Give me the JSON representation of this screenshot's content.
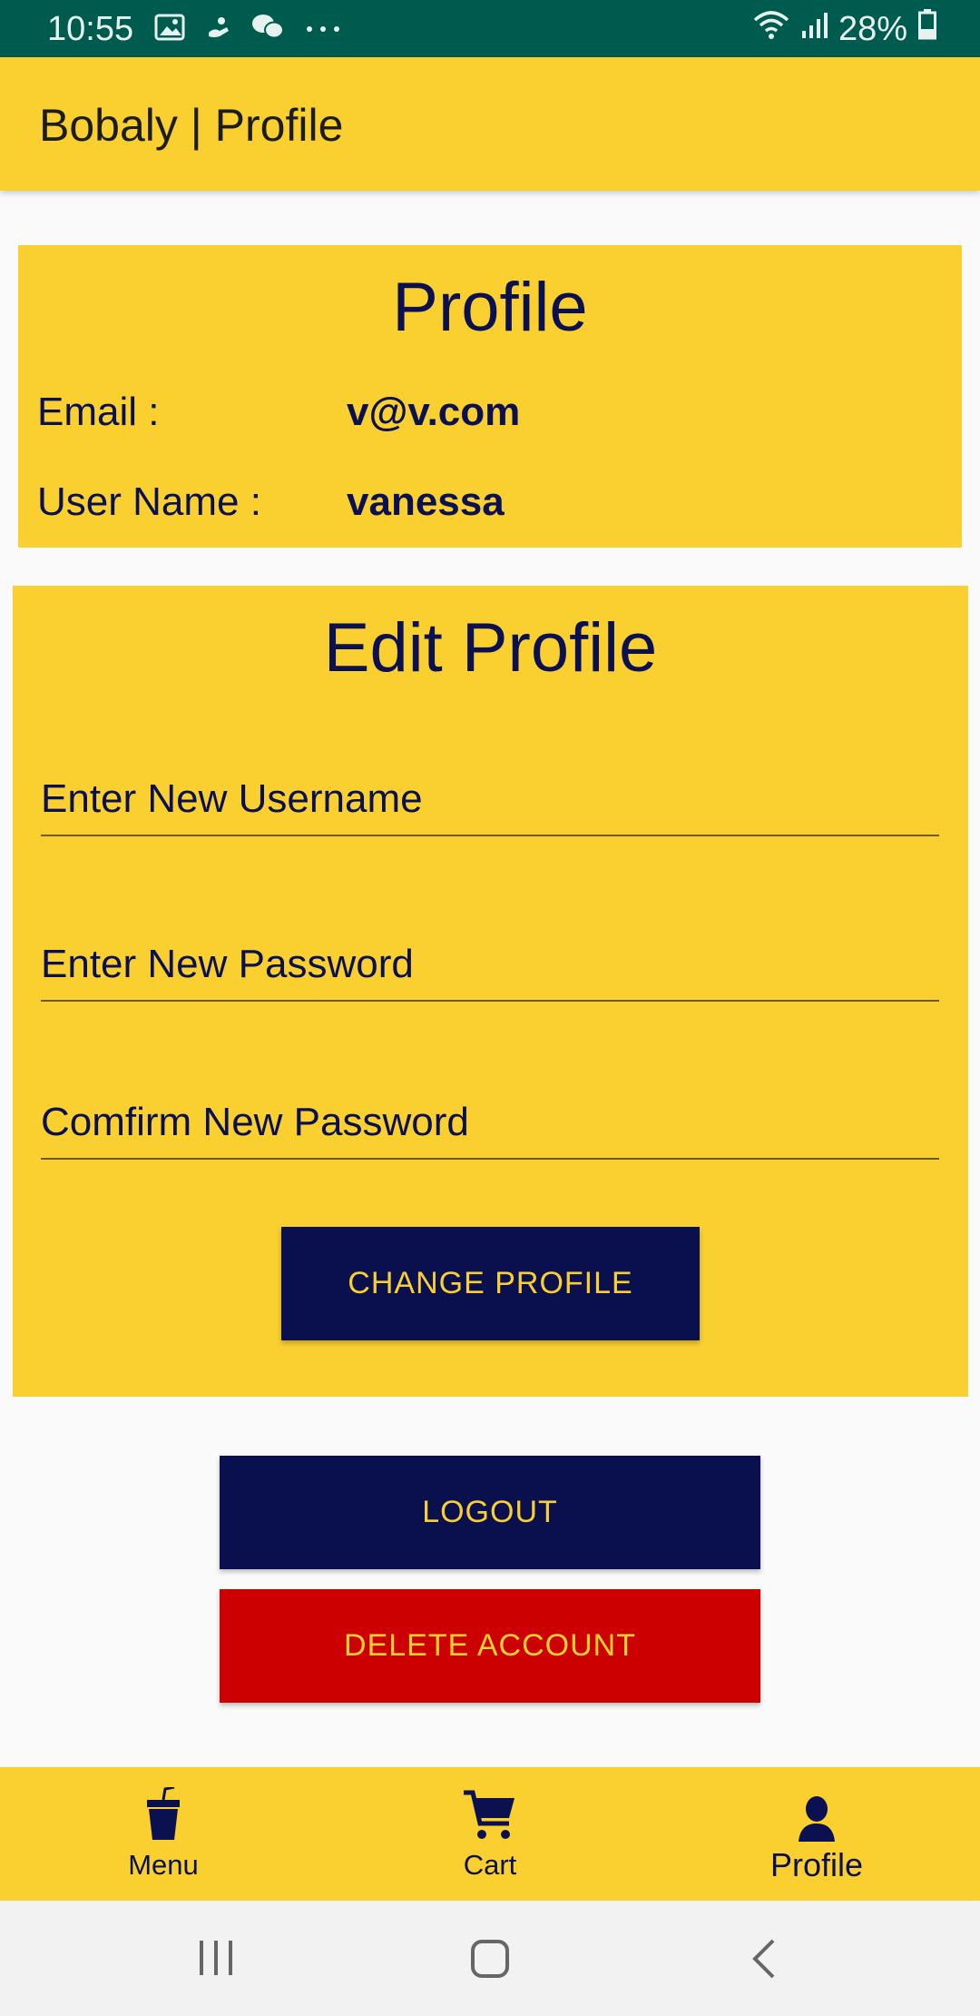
{
  "status_bar": {
    "time": "10:55",
    "battery": "28%"
  },
  "app_bar": {
    "title": "Bobaly | Profile"
  },
  "profile_card": {
    "title": "Profile",
    "email_label": "Email :",
    "email_value": "v@v.com",
    "username_label": "User Name :",
    "username_value": "vanessa"
  },
  "edit_card": {
    "title": "Edit Profile",
    "username_placeholder": "Enter New Username",
    "password_placeholder": "Enter New Password",
    "confirm_placeholder": "Comfirm New Password",
    "change_button": "CHANGE PROFILE"
  },
  "actions": {
    "logout": "LOGOUT",
    "delete": "DELETE ACCOUNT"
  },
  "bottom_nav": {
    "items": [
      {
        "label": "Menu",
        "icon": "drink-cup-icon"
      },
      {
        "label": "Cart",
        "icon": "cart-icon"
      },
      {
        "label": "Profile",
        "icon": "person-icon",
        "active": true
      }
    ]
  },
  "colors": {
    "accent_yellow": "#f9d030",
    "navy": "#09104d",
    "danger_red": "#cc0000",
    "status_bar": "#005b4f"
  }
}
